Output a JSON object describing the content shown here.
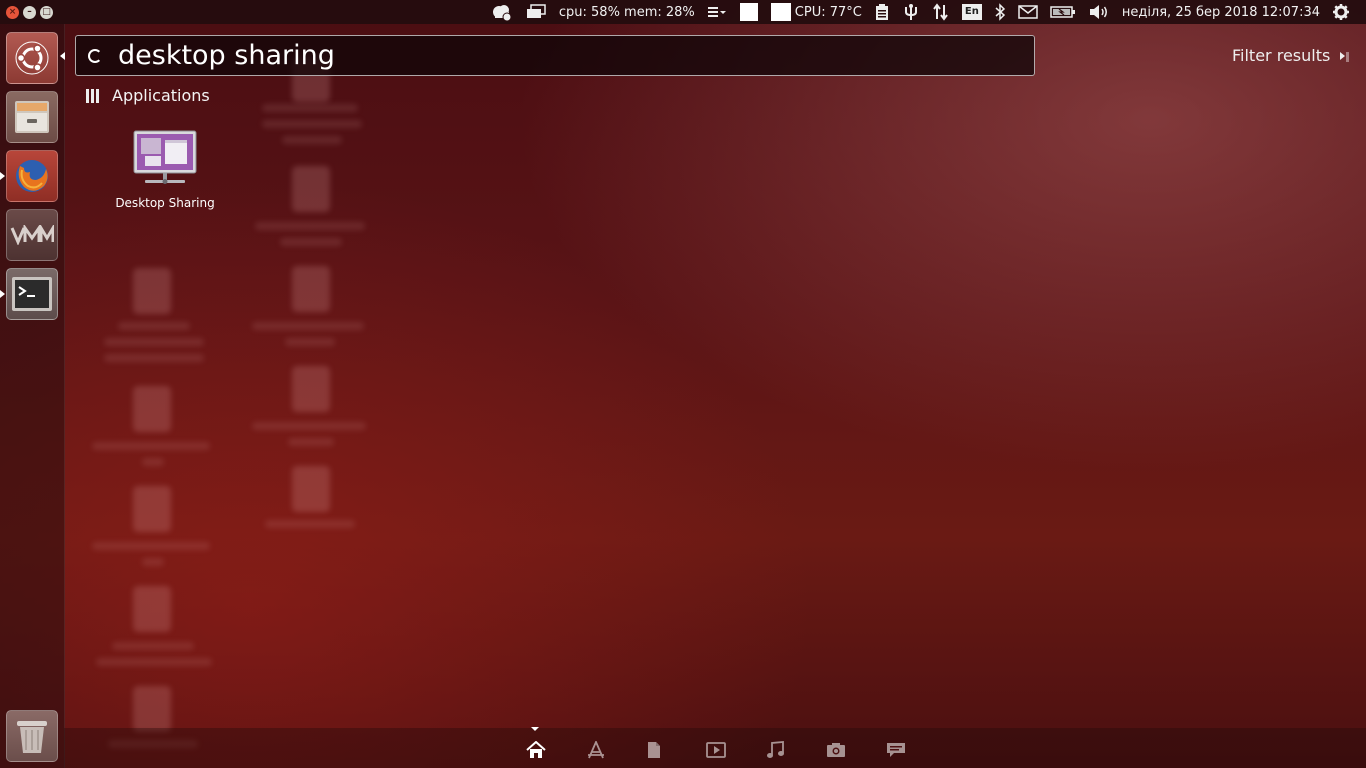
{
  "top_panel": {
    "cpu_mem": "cpu: 58% mem: 28%",
    "cpu_temp": "CPU: 77°C",
    "keyboard_layout": "En",
    "datetime": "неділя, 25 бер 2018 12:07:34"
  },
  "window_controls": {
    "close": "×",
    "minimize": "–",
    "maximize": "□"
  },
  "launcher": {
    "items": [
      {
        "name": "Ubuntu Dash",
        "icon": "ubuntu-logo-icon"
      },
      {
        "name": "Files",
        "icon": "file-cabinet-icon"
      },
      {
        "name": "Firefox",
        "icon": "firefox-icon"
      },
      {
        "name": "VMware",
        "icon": "vmware-icon"
      },
      {
        "name": "Terminal",
        "icon": "terminal-icon"
      },
      {
        "name": "Trash",
        "icon": "trash-icon"
      }
    ]
  },
  "search": {
    "value": "desktop sharing"
  },
  "filter": {
    "label": "Filter results"
  },
  "results": {
    "category": "Applications",
    "apps": [
      {
        "label": "Desktop Sharing",
        "icon": "desktop-sharing-icon"
      }
    ]
  },
  "lenses": [
    {
      "name": "home",
      "icon": "home-icon",
      "active": true
    },
    {
      "name": "applications",
      "icon": "applications-icon"
    },
    {
      "name": "files",
      "icon": "file-icon"
    },
    {
      "name": "video",
      "icon": "video-icon"
    },
    {
      "name": "music",
      "icon": "music-note-icon"
    },
    {
      "name": "photos",
      "icon": "camera-icon"
    },
    {
      "name": "social",
      "icon": "chat-icon"
    }
  ],
  "colors": {
    "accent": "#e6543a",
    "panel": "#230c0e"
  }
}
